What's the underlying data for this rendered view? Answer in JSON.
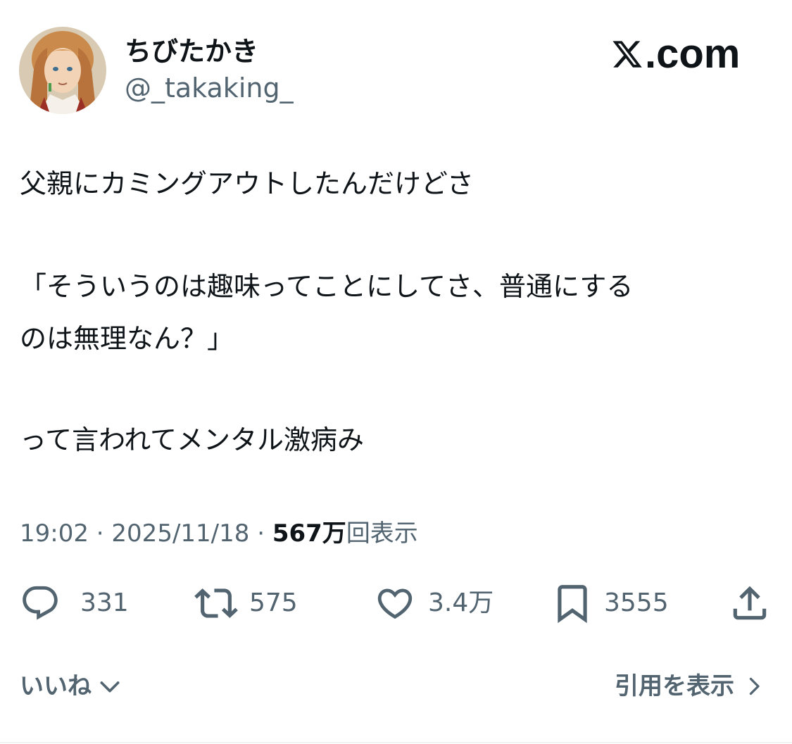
{
  "author": {
    "display_name": "ちびたかき",
    "handle": "@_takaking_"
  },
  "brand": {
    "logo_text": ".com",
    "logo_icon": "x-logo-icon"
  },
  "tweet": {
    "lines": [
      "父親にカミングアウトしたんだけどさ",
      "「そういうのは趣味ってことにしてさ、普通にする",
      "のは無理なん？」",
      "って言われてメンタル激病み"
    ]
  },
  "meta": {
    "time": "19:02",
    "separator": "·",
    "date": "2025/11/18",
    "views_count": "567万",
    "views_label": "回表示"
  },
  "actions": {
    "reply": {
      "icon": "reply-bubble-icon",
      "count": "331"
    },
    "repost": {
      "icon": "repost-icon",
      "count": "575"
    },
    "like": {
      "icon": "heart-icon",
      "count": "3.4万"
    },
    "bookmark": {
      "icon": "bookmark-icon",
      "count": "3555"
    },
    "share": {
      "icon": "share-upload-icon"
    }
  },
  "footer": {
    "likes_label": "いいね",
    "quotes_label": "引用を表示"
  },
  "colors": {
    "text_primary": "#0f1419",
    "text_secondary": "#536471",
    "background": "#ffffff"
  }
}
